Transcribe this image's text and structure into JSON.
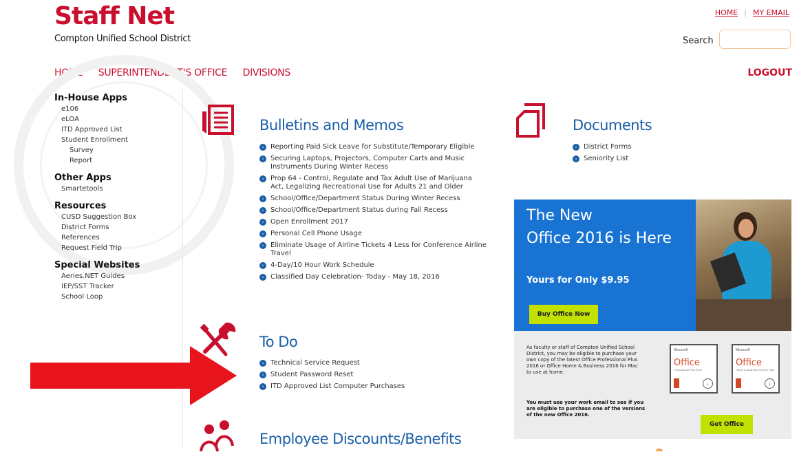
{
  "brand": {
    "title": "Staff Net",
    "subtitle": "Compton Unified School District"
  },
  "toplinks": {
    "home": "HOME",
    "separator": "|",
    "email": "MY EMAIL"
  },
  "search": {
    "label": "Search",
    "placeholder": ""
  },
  "nav": {
    "items": [
      "HOME",
      "SUPERINTENDENT'S OFFICE",
      "DIVISIONS"
    ],
    "logout": "LOGOUT"
  },
  "sidebar": {
    "groups": [
      {
        "heading": "In-House Apps",
        "links": [
          "e106",
          "eLOA",
          "ITD Approved List",
          "Student Enrollment",
          "Survey",
          "Report"
        ]
      },
      {
        "heading": "Other Apps",
        "links": [
          "Smartetools"
        ]
      },
      {
        "heading": "Resources",
        "links": [
          "CUSD Suggestion Box",
          "District Forms",
          "References",
          "Request Field Trip"
        ]
      },
      {
        "heading": "Special Websites",
        "links": [
          "Aeries.NET Guides",
          "IEP/SST Tracker",
          "School Loop"
        ]
      }
    ]
  },
  "bulletins": {
    "title": "Bulletins and Memos",
    "items": [
      "Reporting Paid Sick Leave for Substitute/Temporary Eligible",
      "Securing Laptops, Projectors, Computer Carts and Music Instruments During Winter Recess",
      "Prop 64 - Control, Regulate and Tax Adult Use of Marijuana Act, Legalizing Recreational Use for Adults 21 and Older",
      "School/Office/Department Status During Winter Recess",
      "School/Office/Department Status during Fall Recess",
      "Open Enrollment 2017",
      "Personal Cell Phone Usage",
      "Eliminate Usage of Airline Tickets 4 Less for Conference Airline Travel",
      "4-Day/10 Hour Work Schedule",
      "Classified Day Celebration- Today - May 18, 2016"
    ]
  },
  "todo": {
    "title": "To Do",
    "items": [
      "Technical Service Request",
      "Student Password Reset",
      "ITD Approved List Computer Purchases"
    ]
  },
  "discounts": {
    "title": "Employee Discounts/Benefits"
  },
  "documents": {
    "title": "Documents",
    "items": [
      "District Forms",
      "Seniority List"
    ]
  },
  "promo": {
    "line1": "The New",
    "line2": "Office 2016 is Here",
    "price": "Yours for Only $9.95",
    "button": "Buy Office Now",
    "body": "As faculty or staff of Compton Unified School District, you may be eligible to purchase your own copy of the latest Office Professional Plus 2016 or Office Home & Business 2016 for Mac to use at home.",
    "note": "You must use your work email to see if you are eligible to purchase one of the versions of the new Office 2016.",
    "button2": "Get Office",
    "box1": {
      "brand": "Microsoft",
      "name": "Office",
      "edition": "Professional Plus 2016"
    },
    "box2": {
      "brand": "Microsoft",
      "name": "Office",
      "edition": "Home & Business 2016 for Mac"
    }
  },
  "colors": {
    "brand_red": "#c8102e",
    "link_blue": "#1a5ea8",
    "promo_blue": "#1873d3",
    "promo_green": "#c3e100"
  }
}
